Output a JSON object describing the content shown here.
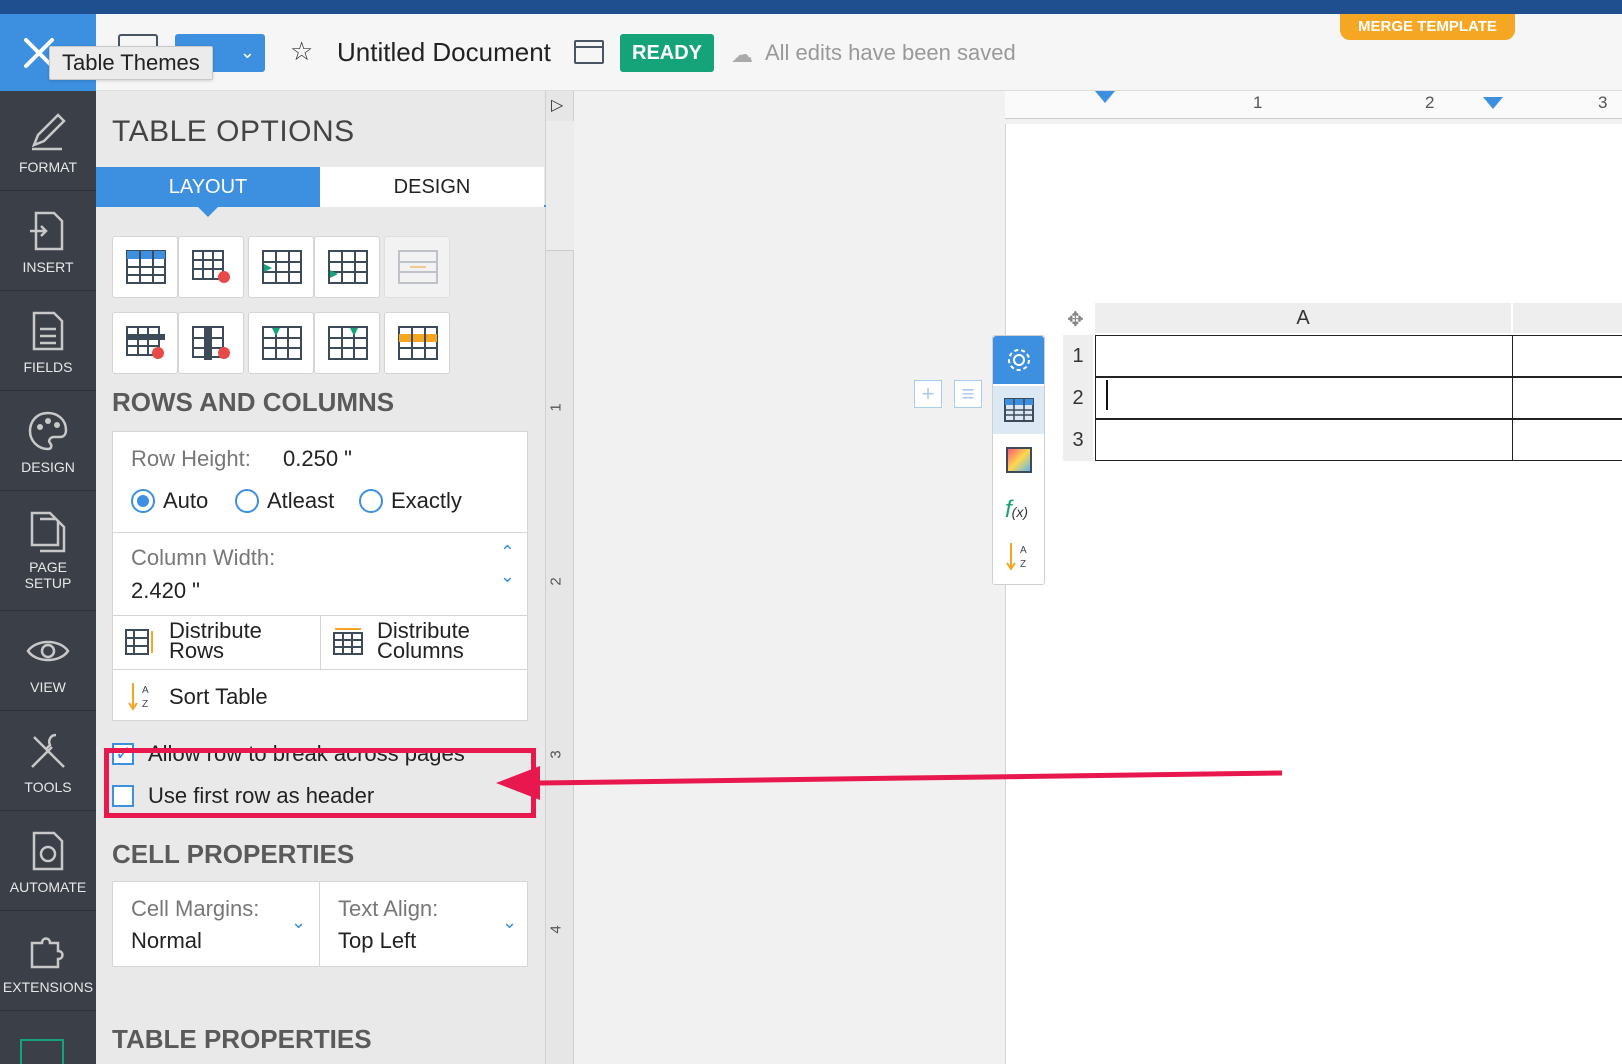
{
  "header": {
    "tooltip": "Table Themes",
    "doc_title": "Untitled Document",
    "status_badge": "READY",
    "save_status": "All edits have been saved",
    "merge_button": "MERGE TEMPLATE",
    "accent_color": "#3d8fe0",
    "ready_color": "#15a37a",
    "merge_color": "#f5a623"
  },
  "leftnav": {
    "items": [
      {
        "label": "FORMAT",
        "icon": "pen-icon"
      },
      {
        "label": "INSERT",
        "icon": "insert-doc-icon"
      },
      {
        "label": "FIELDS",
        "icon": "fields-doc-icon"
      },
      {
        "label": "DESIGN",
        "icon": "palette-icon"
      },
      {
        "label": "PAGE SETUP",
        "icon": "page-setup-icon"
      },
      {
        "label": "VIEW",
        "icon": "eye-icon"
      },
      {
        "label": "TOOLS",
        "icon": "tools-icon"
      },
      {
        "label": "AUTOMATE",
        "icon": "automate-gear-doc-icon"
      },
      {
        "label": "EXTENSIONS",
        "icon": "puzzle-icon"
      }
    ]
  },
  "panel": {
    "title": "TABLE OPTIONS",
    "tabs": {
      "layout": "LAYOUT",
      "design": "DESIGN"
    },
    "rows_columns_heading": "ROWS AND COLUMNS",
    "row_height_label": "Row Height:",
    "row_height_value": "0.250 \"",
    "radio_auto": "Auto",
    "radio_atleast": "Atleast",
    "radio_exactly": "Exactly",
    "column_width_label": "Column Width:",
    "column_width_value": "2.420 \"",
    "distribute_rows_1": "Distribute",
    "distribute_rows_2": "Rows",
    "distribute_cols_1": "Distribute",
    "distribute_cols_2": "Columns",
    "sort_table": "Sort Table",
    "allow_break": "Allow row to break across pages",
    "first_row_header": "Use first row as header",
    "cell_properties_heading": "CELL PROPERTIES",
    "cell_margins_label": "Cell Margins:",
    "cell_margins_value": "Normal",
    "text_align_label": "Text Align:",
    "text_align_value": "Top Left",
    "table_properties_heading": "TABLE PROPERTIES"
  },
  "rulers": {
    "horizontal": [
      "1",
      "2",
      "3"
    ],
    "vertical": [
      "1",
      "2",
      "3",
      "4"
    ]
  },
  "table": {
    "column_header": "A",
    "row_numbers": [
      "1",
      "2",
      "3"
    ]
  }
}
